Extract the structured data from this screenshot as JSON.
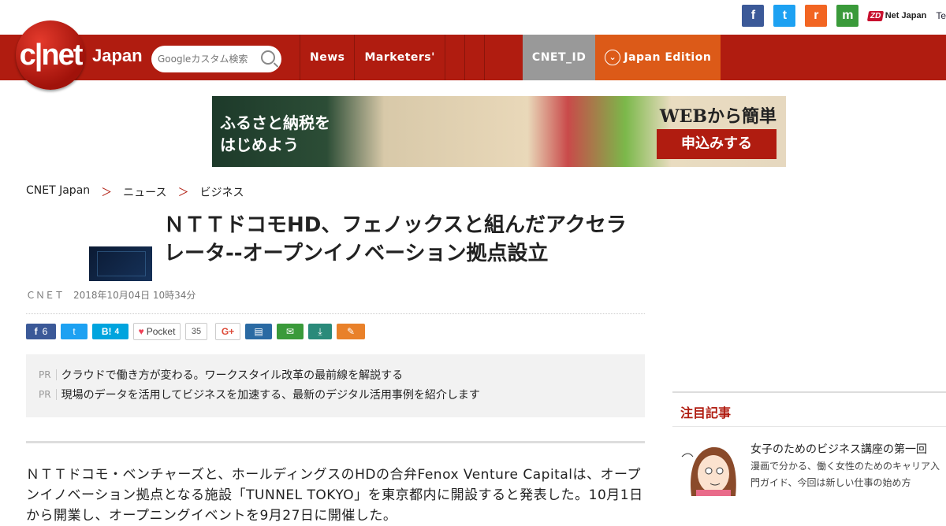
{
  "header": {
    "social": {
      "facebook": "f",
      "twitter": "t",
      "rss": "r",
      "mail": "m"
    },
    "zdnet": {
      "zd": "ZD",
      "label": "Net Japan"
    },
    "techrepublic": "Te",
    "logo_text": "c|net",
    "logo_sub": "Japan",
    "search_placeholder": "Googleカスタム検索",
    "nav": [
      "News",
      "Marketers'"
    ],
    "cnet_id": "CNET_ID",
    "edition": "Japan Edition"
  },
  "banner": {
    "left_text": "ふるさと納税をはじめよう",
    "right_text": "WEBから簡単",
    "button": "申込みする"
  },
  "breadcrumb": [
    "CNET Japan",
    "＞",
    "ニュース",
    "＞",
    "ビジネス"
  ],
  "article": {
    "title": "ＮＴＴドコモHD、フェノックスと組んだアクセラレータ--オープンイノベーション拠点設立",
    "date": "ＣＮＥＴ　2018年10月04日 10時34分",
    "share": {
      "fb_count": "6",
      "hatena": "B!",
      "hatena_count": "4",
      "pocket": "Pocket",
      "pocket_count": "35",
      "gplus": "G+"
    },
    "pr": [
      {
        "tag": "PR",
        "text": "クラウドで働き方が変わる。ワークスタイル改革の最前線を解説する"
      },
      {
        "tag": "PR",
        "text": "現場のデータを活用してビジネスを加速する、最新のデジタル活用事例を紹介します"
      }
    ],
    "body": "ＮＴＴドコモ・ベンチャーズと、ホールディングスのHDの合弁Fenox Venture Capitalは、オープンイノベーション拠点となる施設「TUNNEL TOKYO」を東京都内に開設すると発表した。10月1日から開業し、オープニングイベントを9月27日に開催した。"
  },
  "sidebar": {
    "heading": "注目記事",
    "item_title": "女子のためのビジネス講座の第一回",
    "item_desc": "漫画で分かる、働く女性のためのキャリア入門ガイド、今回は新しい仕事の始め方"
  },
  "colors": {
    "brand_red": "#b01c10",
    "edition_orange": "#dc5a18",
    "cnetid_gray": "#999999"
  }
}
